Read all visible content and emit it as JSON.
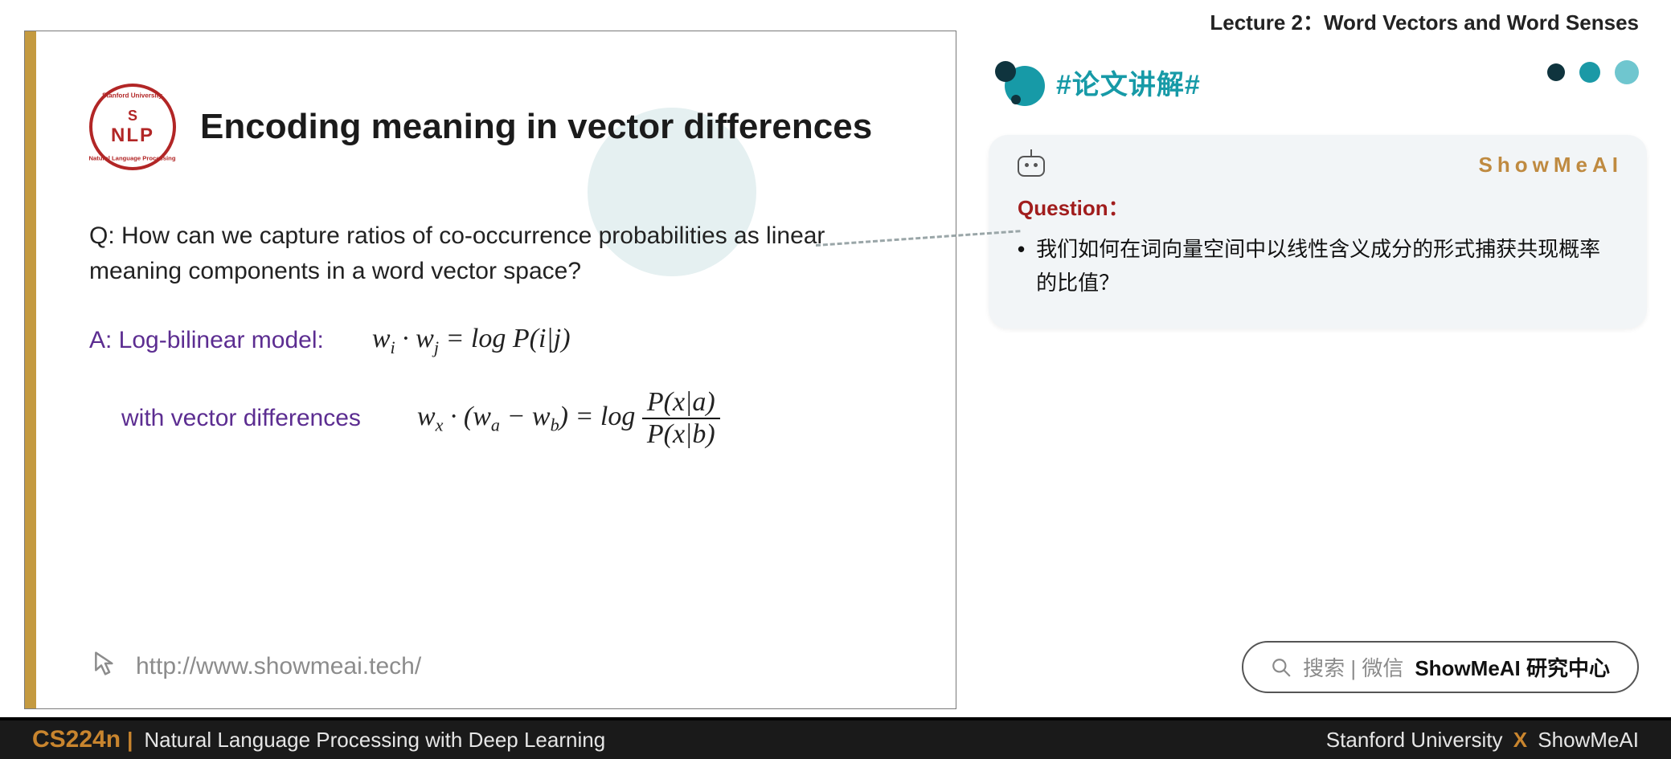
{
  "lecture_header": "Lecture 2：Word Vectors and Word Senses",
  "slide": {
    "logo": {
      "top_arc": "Stanford University",
      "letter": "S",
      "nlp": "NLP",
      "bottom_arc": "Natural Language Processing"
    },
    "title": "Encoding meaning in vector differences",
    "question": "Q: How can we capture ratios of co-occurrence probabilities as linear meaning components in a word vector space?",
    "answer_label": "A: Log-bilinear model:",
    "formula1_wi": "w",
    "formula1_i": "i",
    "formula1_dot": " · ",
    "formula1_wj": "w",
    "formula1_j": "j",
    "formula1_eq": " = log P(i|j)",
    "with_label": "with vector differences",
    "formula2_pre": "w",
    "formula2_x": "x",
    "formula2_mid1": " · (w",
    "formula2_a": "a",
    "formula2_mid2": " − w",
    "formula2_b": "b",
    "formula2_mid3": ") = log ",
    "formula2_num": "P(x|a)",
    "formula2_den": "P(x|b)",
    "footer_url": "http://www.showmeai.tech/"
  },
  "right": {
    "section_title": "#论文讲解#",
    "brand": "ShowMeAI",
    "q_label": "Question：",
    "bullet": "我们如何在词向量空间中以线性含义成分的形式捕获共现概率的比值？"
  },
  "search": {
    "grey": "搜索 | 微信",
    "bold": "ShowMeAI 研究中心"
  },
  "bottom": {
    "code": "CS224n",
    "pipe": "|",
    "name": "Natural Language Processing with Deep Learning",
    "right_a": "Stanford University",
    "right_x": "X",
    "right_b": "ShowMeAI"
  }
}
